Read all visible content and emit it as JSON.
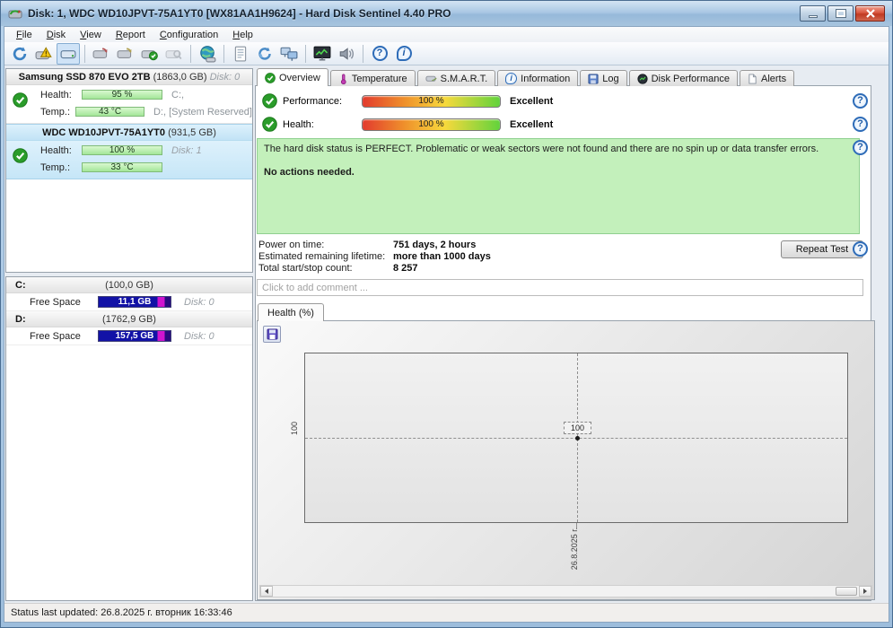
{
  "glyphs": {
    "help": "?",
    "info": "i"
  },
  "window": {
    "title": "Disk: 1, WDC WD10JPVT-75A1YT0 [WX81AA1H9624]  -  Hard Disk Sentinel 4.40 PRO"
  },
  "menu": {
    "items": [
      {
        "label": "File"
      },
      {
        "label": "Disk"
      },
      {
        "label": "View"
      },
      {
        "label": "Report"
      },
      {
        "label": "Configuration"
      },
      {
        "label": "Help"
      }
    ]
  },
  "toolbar": {
    "icons": [
      "refresh",
      "disk-alert",
      "disk-detect",
      "disk-remove",
      "disk-retest",
      "disk-accept",
      "disk-search",
      "world-status",
      "report",
      "sync-disk",
      "network",
      "performance-monitor",
      "sound",
      "help",
      "information"
    ]
  },
  "sidebar": {
    "disks": [
      {
        "name": "Samsung SSD 870 EVO 2TB",
        "size": "(1863,0 GB)",
        "disk_no": "Disk: 0",
        "health_label": "Health:",
        "health_value": "95 %",
        "row1_right": "C:,",
        "temp_label": "Temp.:",
        "temp_value": "43 °C",
        "row2_right": "D:, [System Reserved]"
      },
      {
        "name": "WDC WD10JPVT-75A1YT0",
        "size": "(931,5 GB)",
        "health_label": "Health:",
        "health_value": "100 %",
        "row1_right": "Disk: 1",
        "temp_label": "Temp.:",
        "temp_value": "33 °C",
        "row2_right": ""
      }
    ],
    "partitions": [
      {
        "letter": "C:",
        "size": "(100,0 GB)",
        "free_label": "Free Space",
        "free_value": "11,1 GB",
        "disk_no": "Disk: 0"
      },
      {
        "letter": "D:",
        "size": "(1762,9 GB)",
        "free_label": "Free Space",
        "free_value": "157,5 GB",
        "disk_no": "Disk: 0"
      }
    ]
  },
  "tabs": [
    {
      "label": "Overview"
    },
    {
      "label": "Temperature"
    },
    {
      "label": "S.M.A.R.T."
    },
    {
      "label": "Information"
    },
    {
      "label": "Log"
    },
    {
      "label": "Disk Performance"
    },
    {
      "label": "Alerts"
    }
  ],
  "overview": {
    "performance_label": "Performance:",
    "performance_value": "100 %",
    "performance_rating": "Excellent",
    "health_label": "Health:",
    "health_value": "100 %",
    "health_rating": "Excellent",
    "status_line1": "The hard disk status is PERFECT. Problematic or weak sectors were not found and there are no spin up or data transfer errors.",
    "status_line2": "No actions needed.",
    "stats": [
      {
        "label": "Power on time:",
        "value": "751 days, 2 hours"
      },
      {
        "label": "Estimated remaining lifetime:",
        "value": "more than 1000 days"
      },
      {
        "label": "Total start/stop count:",
        "value": "8 257"
      }
    ],
    "repeat_test": "Repeat Test",
    "comment_placeholder": "Click to add comment ..."
  },
  "chart": {
    "tab_label": "Health (%)"
  },
  "chart_data": {
    "type": "line",
    "title": "Health (%)",
    "x": [
      "26.8.2025 г."
    ],
    "series": [
      {
        "name": "Health %",
        "values": [
          100
        ]
      }
    ],
    "point_label": "100",
    "y_tick": "100",
    "x_tick": "26.8.2025 г.",
    "grid": "dashed-crosshair",
    "legend": "none"
  },
  "status_bar": {
    "text": "Status last updated: 26.8.2025 г. вторник 16:33:46"
  },
  "colors": {
    "titlebar": "#aac8e4",
    "selected_disk": "#d8eefb",
    "health_bar": "#a3e698",
    "free_bar_blue": "#1212a6",
    "free_bar_magenta": "#cf14cf",
    "status_box": "#c3f0bb",
    "meter_gradient": [
      "#e23b2e",
      "#ef8f2b",
      "#f7d93c",
      "#62d33c"
    ]
  }
}
